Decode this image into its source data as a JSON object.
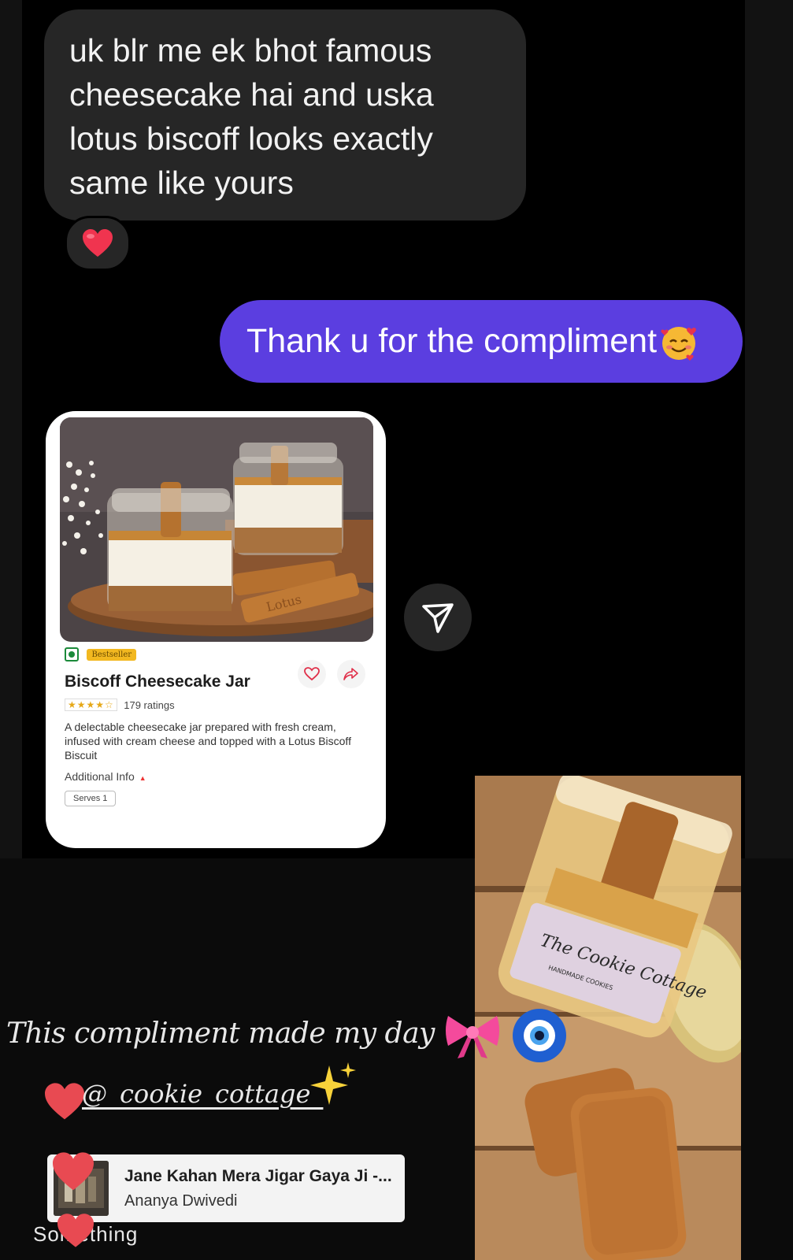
{
  "chat": {
    "incoming_message": "uk blr me ek bhot famous cheesecake hai and uska lotus biscoff looks exactly same like yours",
    "outgoing_message": "Thank u for the compliment"
  },
  "product_card": {
    "badge": "Bestseller",
    "title": "Biscoff Cheesecake Jar",
    "stars": "★★★★☆",
    "ratings": "179 ratings",
    "description": "A delectable cheesecake jar prepared with fresh cream, infused with cream cheese and topped with a Lotus Biscoff Biscuit",
    "additional_info": "Additional Info",
    "serves": "Serves 1",
    "photo_text": "Lotus"
  },
  "story": {
    "caption": "This compliment made my day",
    "mention": "@_cookie_cottage_",
    "jar_label": "The Cookie Cottage",
    "jar_label_sub": "HANDMADE COOKIES"
  },
  "music": {
    "title": "Jane Kahan Mera Jigar Gaya Ji -...",
    "artist": "Ananya Dwivedi"
  },
  "cut_text": "Something",
  "colors": {
    "incoming_bubble": "#262626",
    "outgoing_bubble": "#5b3ee0",
    "heart": "#f0344f"
  }
}
